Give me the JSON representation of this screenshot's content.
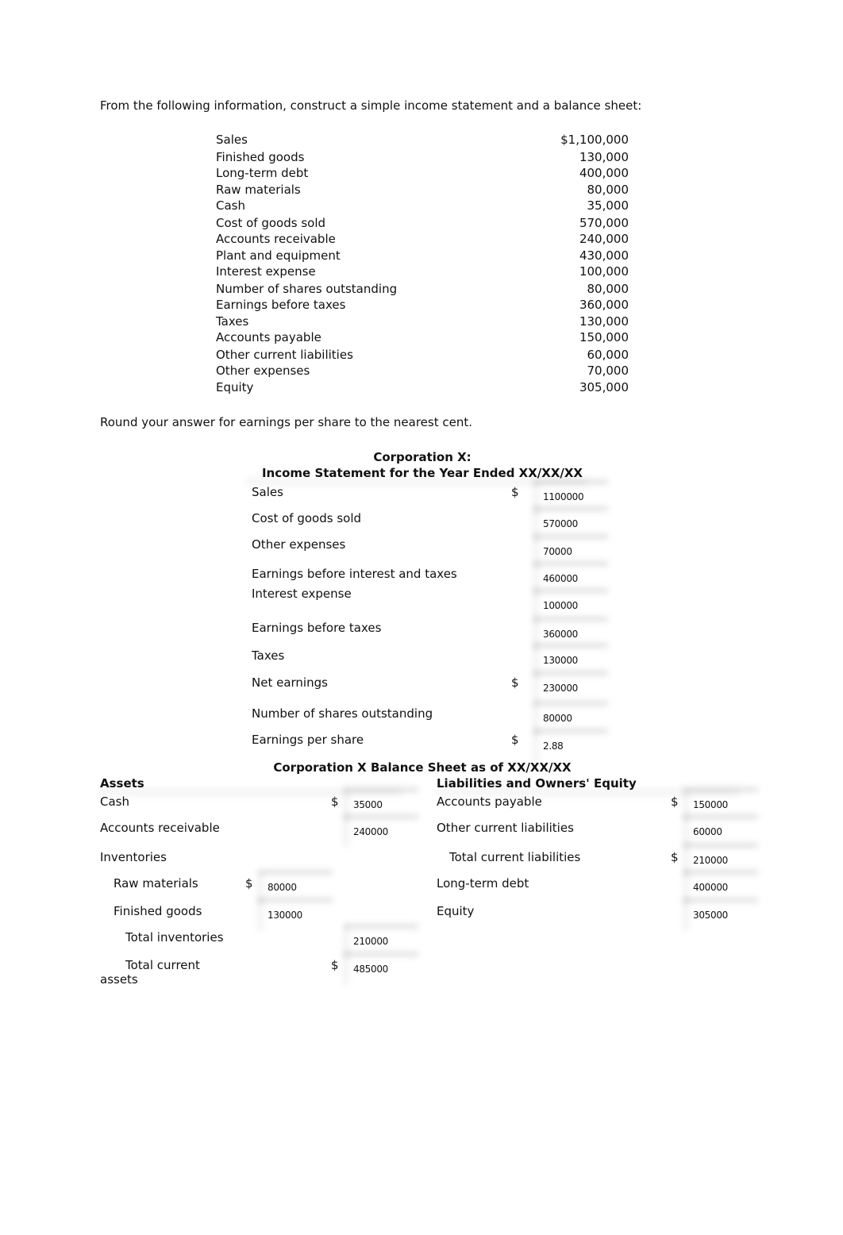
{
  "intro": "From the following information, construct a simple income statement and a balance sheet:",
  "given": [
    {
      "label": "Sales",
      "value": "$1,100,000"
    },
    {
      "label": "Finished goods",
      "value": "130,000"
    },
    {
      "label": "Long-term debt",
      "value": "400,000"
    },
    {
      "label": "Raw materials",
      "value": "80,000"
    },
    {
      "label": "Cash",
      "value": "35,000"
    },
    {
      "label": "Cost of goods sold",
      "value": "570,000"
    },
    {
      "label": "Accounts receivable",
      "value": "240,000"
    },
    {
      "label": "Plant and equipment",
      "value": "430,000"
    },
    {
      "label": "Interest expense",
      "value": "100,000"
    },
    {
      "label": "Number of shares outstanding",
      "value": "80,000"
    },
    {
      "label": "Earnings before taxes",
      "value": "360,000"
    },
    {
      "label": "Taxes",
      "value": "130,000"
    },
    {
      "label": "Accounts payable",
      "value": "150,000"
    },
    {
      "label": "Other current liabilities",
      "value": "60,000"
    },
    {
      "label": "Other expenses",
      "value": "70,000"
    },
    {
      "label": "Equity",
      "value": "305,000"
    }
  ],
  "instruction": "Round your answer for earnings per share to the nearest cent.",
  "income_statement": {
    "title_line1": "Corporation X:",
    "title_line2": "Income Statement for the Year Ended XX/XX/XX",
    "rows": [
      {
        "label": "Sales",
        "currency": "$",
        "value": "1100000"
      },
      {
        "label": "Cost of goods sold",
        "currency": "",
        "value": "570000"
      },
      {
        "label": "Other expenses",
        "currency": "",
        "value": "70000"
      },
      {
        "label": "Earnings before interest and taxes",
        "currency": "",
        "value": "460000"
      },
      {
        "label": "Interest expense",
        "currency": "",
        "value": "100000"
      },
      {
        "label": "Earnings before taxes",
        "currency": "",
        "value": "360000"
      },
      {
        "label": "Taxes",
        "currency": "",
        "value": "130000"
      },
      {
        "label": "Net earnings",
        "currency": "$",
        "value": "230000"
      },
      {
        "label": "Number of shares outstanding",
        "currency": "",
        "value": "80000"
      },
      {
        "label": "Earnings per share",
        "currency": "$",
        "value": "2.88"
      }
    ]
  },
  "balance_sheet": {
    "title": "Corporation X Balance Sheet as of XX/XX/XX",
    "assets_header": "Assets",
    "liabilities_header": "Liabilities and Owners' Equity",
    "assets": {
      "cash": {
        "label": "Cash",
        "currency": "$",
        "value": "35000"
      },
      "accounts_receivable": {
        "label": "Accounts receivable",
        "currency": "",
        "value": "240000"
      },
      "inventories_label": "Inventories",
      "raw_materials": {
        "label": "Raw materials",
        "currency": "$",
        "value": "80000"
      },
      "finished_goods": {
        "label": "Finished goods",
        "currency": "",
        "value": "130000"
      },
      "total_inventories": {
        "label": "Total inventories",
        "currency": "",
        "value": "210000"
      },
      "total_current_assets": {
        "label_line1": "Total current",
        "label_line2": "assets",
        "currency": "$",
        "value": "485000"
      }
    },
    "liabilities": {
      "accounts_payable": {
        "label": "Accounts payable",
        "currency": "$",
        "value": "150000"
      },
      "other_current_liabilities": {
        "label": "Other current liabilities",
        "currency": "",
        "value": "60000"
      },
      "total_current_liabilities": {
        "label": "Total current liabilities",
        "currency": "$",
        "value": "210000"
      },
      "long_term_debt": {
        "label": "Long-term debt",
        "currency": "",
        "value": "400000"
      },
      "equity": {
        "label": "Equity",
        "currency": "",
        "value": "305000"
      }
    }
  }
}
